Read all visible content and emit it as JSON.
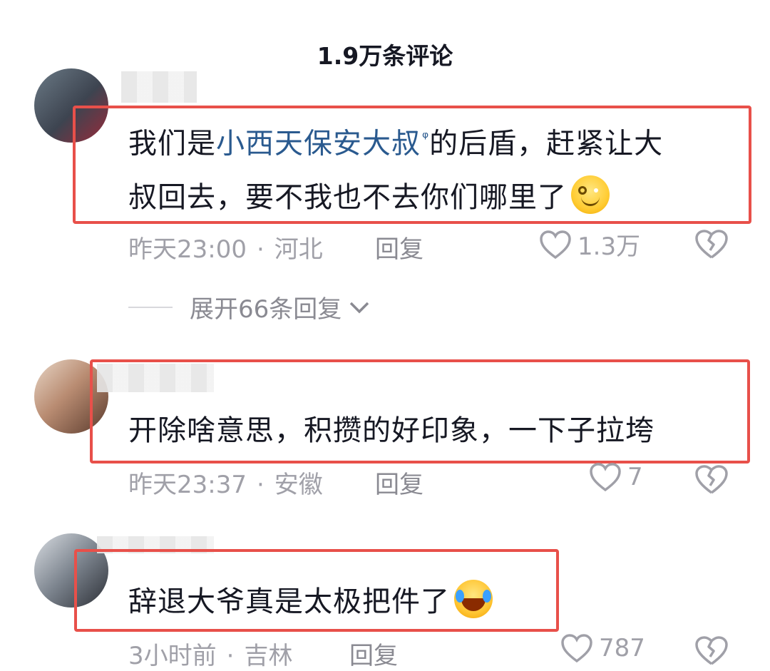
{
  "header": {
    "title": "1.9万条评论"
  },
  "comments": [
    {
      "text_before": "我们是",
      "keyword": "小西天保安大叔",
      "search_mark": "ᵠ",
      "text_after_line1": "的后盾，赶紧让大",
      "text_line2": "叔回去，要不我也不去你们哪里了",
      "emoji": "smile-emoji",
      "time": "昨天23:00",
      "location": "河北",
      "reply_label": "回复",
      "likes": "1.3万",
      "expand_label": "展开66条回复"
    },
    {
      "text": "开除啥意思，积攒的好印象，一下子拉垮",
      "time": "昨天23:37",
      "location": "安徽",
      "reply_label": "回复",
      "likes": "7"
    },
    {
      "text": "辞退大爷真是太极把件了",
      "emoji": "laughing-tears-emoji",
      "time": "3小时前",
      "location": "吉林",
      "reply_label": "回复",
      "likes": "787"
    }
  ],
  "colors": {
    "highlight": "#e8504a",
    "keyword": "#2a5a8f",
    "meta": "#a0a0a8"
  },
  "separator": "·"
}
